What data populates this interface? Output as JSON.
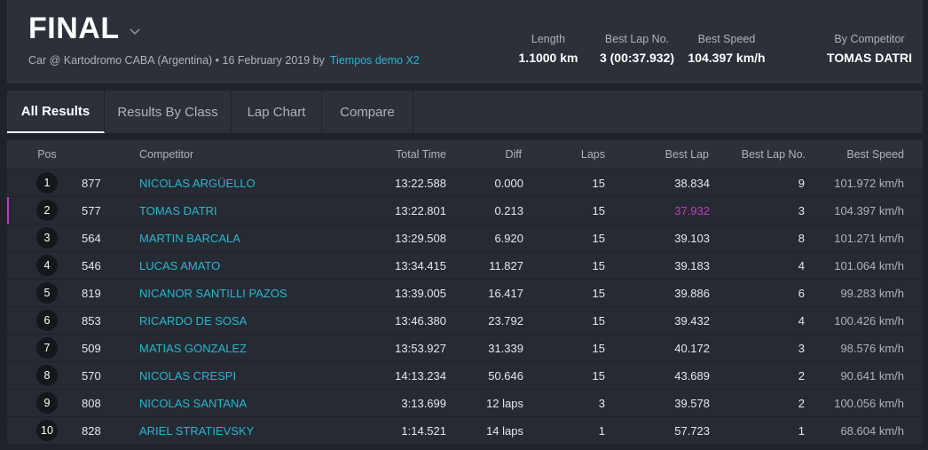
{
  "header": {
    "title": "FINAL",
    "subtitle": "Car @ Kartodromo CABA (Argentina) • 16 February 2019 by",
    "subtitle_link": "Tiempos demo X2",
    "stats": [
      {
        "label": "Length",
        "value": "1.1000 km"
      },
      {
        "label": "Best Lap No.",
        "value": "3 (00:37.932)"
      },
      {
        "label": "Best Speed",
        "value": "104.397 km/h"
      },
      {
        "label": "By Competitor",
        "value": "TOMAS DATRI"
      }
    ]
  },
  "tabs": [
    "All Results",
    "Results By Class",
    "Lap Chart",
    "Compare"
  ],
  "columns": {
    "pos": "Pos",
    "competitor": "Competitor",
    "total": "Total Time",
    "diff": "Diff",
    "laps": "Laps",
    "best_lap": "Best Lap",
    "best_lap_no": "Best Lap No.",
    "best_speed": "Best Speed"
  },
  "rows": [
    {
      "pos": "1",
      "num": "877",
      "name": "NICOLAS ARGÜELLO",
      "total": "13:22.588",
      "diff": "0.000",
      "laps": "15",
      "best_lap": "38.834",
      "best_lap_no": "9",
      "speed": "101.972 km/h"
    },
    {
      "pos": "2",
      "num": "577",
      "name": "TOMAS DATRI",
      "total": "13:22.801",
      "diff": "0.213",
      "laps": "15",
      "best_lap": "37.932",
      "best_lap_no": "3",
      "speed": "104.397 km/h"
    },
    {
      "pos": "3",
      "num": "564",
      "name": "MARTIN BARCALA",
      "total": "13:29.508",
      "diff": "6.920",
      "laps": "15",
      "best_lap": "39.103",
      "best_lap_no": "8",
      "speed": "101.271 km/h"
    },
    {
      "pos": "4",
      "num": "546",
      "name": "LUCAS AMATO",
      "total": "13:34.415",
      "diff": "11.827",
      "laps": "15",
      "best_lap": "39.183",
      "best_lap_no": "4",
      "speed": "101.064 km/h"
    },
    {
      "pos": "5",
      "num": "819",
      "name": "NICANOR SANTILLI PAZOS",
      "total": "13:39.005",
      "diff": "16.417",
      "laps": "15",
      "best_lap": "39.886",
      "best_lap_no": "6",
      "speed": "99.283 km/h"
    },
    {
      "pos": "6",
      "num": "853",
      "name": "RICARDO DE SOSA",
      "total": "13:46.380",
      "diff": "23.792",
      "laps": "15",
      "best_lap": "39.432",
      "best_lap_no": "4",
      "speed": "100.426 km/h"
    },
    {
      "pos": "7",
      "num": "509",
      "name": "MATIAS GONZALEZ",
      "total": "13:53.927",
      "diff": "31.339",
      "laps": "15",
      "best_lap": "40.172",
      "best_lap_no": "3",
      "speed": "98.576 km/h"
    },
    {
      "pos": "8",
      "num": "570",
      "name": "NICOLAS CRESPI",
      "total": "14:13.234",
      "diff": "50.646",
      "laps": "15",
      "best_lap": "43.689",
      "best_lap_no": "2",
      "speed": "90.641 km/h"
    },
    {
      "pos": "9",
      "num": "808",
      "name": "NICOLAS SANTANA",
      "total": "3:13.699",
      "diff": "12 laps",
      "laps": "3",
      "best_lap": "39.578",
      "best_lap_no": "2",
      "speed": "100.056 km/h"
    },
    {
      "pos": "10",
      "num": "828",
      "name": "ARIEL STRATIEVSKY",
      "total": "1:14.521",
      "diff": "14 laps",
      "laps": "1",
      "best_lap": "57.723",
      "best_lap_no": "1",
      "speed": "68.604 km/h"
    }
  ],
  "colors": {
    "accent": "#2bb5cf",
    "best_lap_highlight": "#c33bc3"
  },
  "icons": {
    "title_dropdown": "chevron-down-icon"
  }
}
